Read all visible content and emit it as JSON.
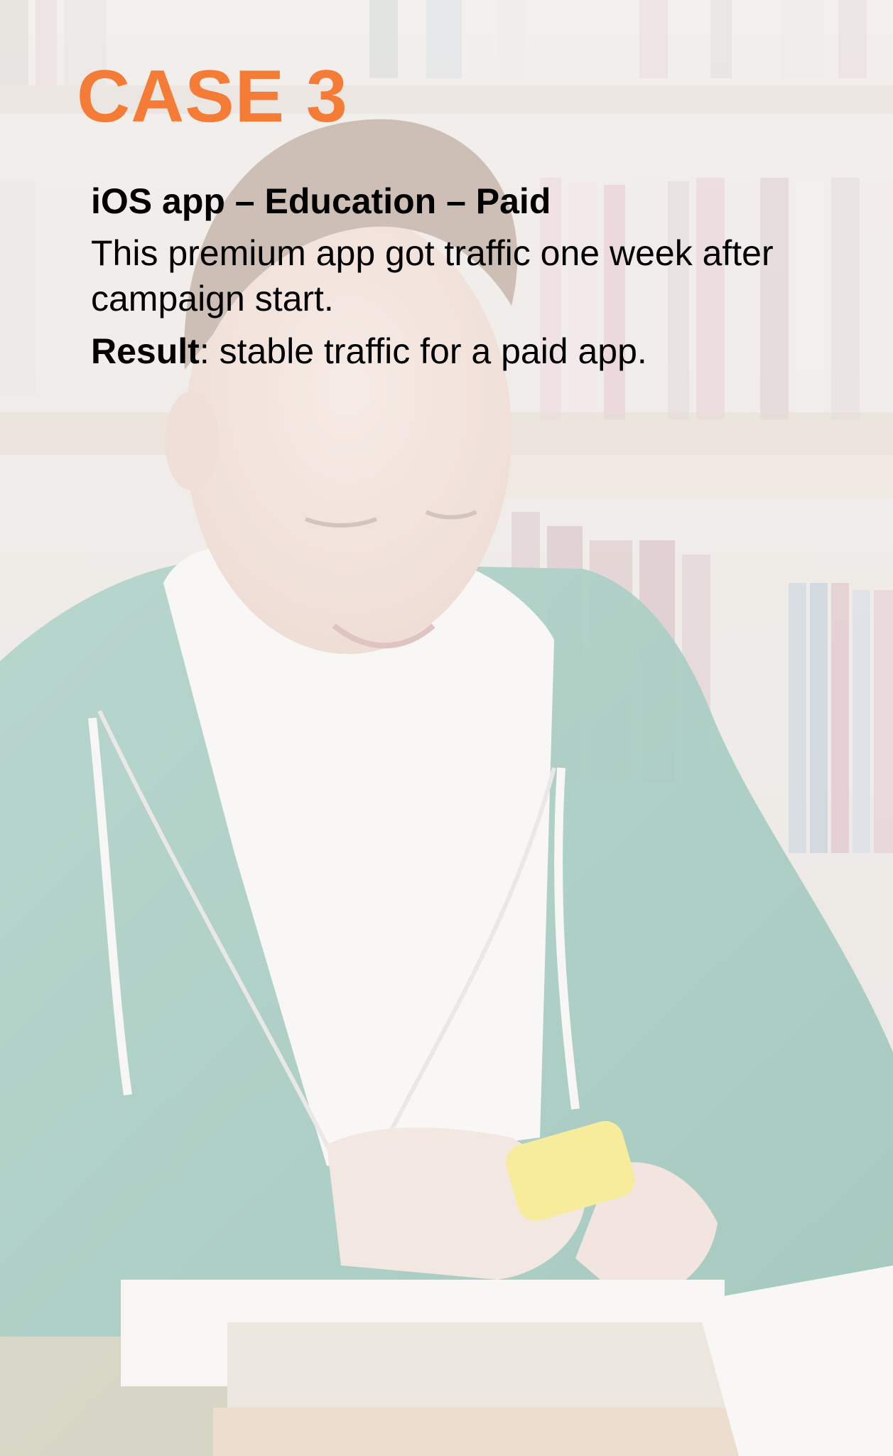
{
  "case": {
    "title": "CASE 3",
    "title_color": "#f57c36"
  },
  "info": {
    "subtitle": "iOS app – Education – Paid",
    "description": "This premium app got traffic one week after campaign start.",
    "result_label": "Result",
    "result_text": ": stable traffic for a paid app."
  }
}
